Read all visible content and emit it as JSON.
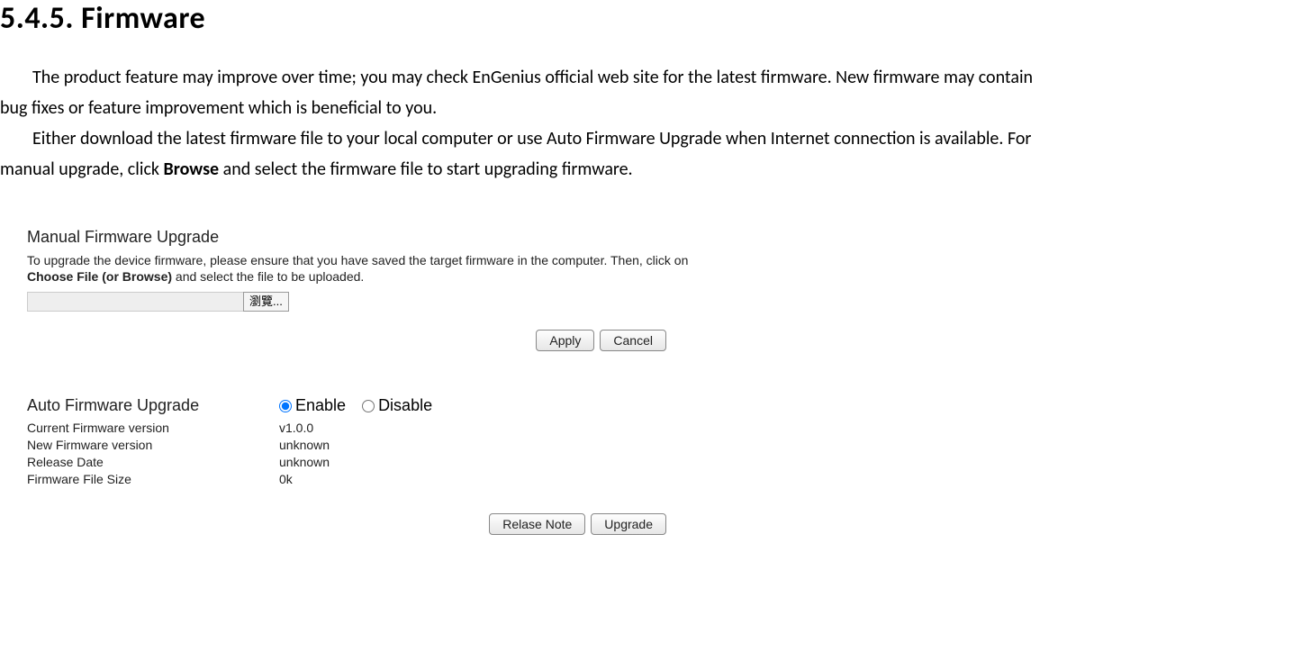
{
  "heading": "5.4.5.  Firmware",
  "para1a": "The product feature may improve over time; you may check EnGenius official web site for the latest firmware. New firmware may contain",
  "para1b": "bug fixes or feature improvement which is beneficial to you.",
  "para2a": "Either download the latest firmware file to your local computer or use Auto Firmware Upgrade when Internet connection is available. For",
  "para2b_pre": "manual upgrade, click ",
  "para2b_bold": "Browse",
  "para2b_post": " and select the firmware file to start upgrading firmware.",
  "manual": {
    "title": "Manual Firmware Upgrade",
    "desc_pre": "To upgrade the device firmware, please ensure that you have saved the target firmware in the computer. Then, click on ",
    "desc_bold": "Choose File (or Browse)",
    "desc_post": " and select the file to be uploaded.",
    "browse_label": "瀏覽...",
    "apply": "Apply",
    "cancel": "Cancel"
  },
  "auto": {
    "title": "Auto Firmware Upgrade",
    "enable": "Enable",
    "disable": "Disable",
    "rows": [
      {
        "label": "Current Firmware version",
        "value": "v1.0.0"
      },
      {
        "label": "New Firmware version",
        "value": "unknown"
      },
      {
        "label": "Release Date",
        "value": "unknown"
      },
      {
        "label": "Firmware File Size",
        "value": "0k"
      }
    ],
    "release_note": "Relase Note",
    "upgrade": "Upgrade"
  }
}
